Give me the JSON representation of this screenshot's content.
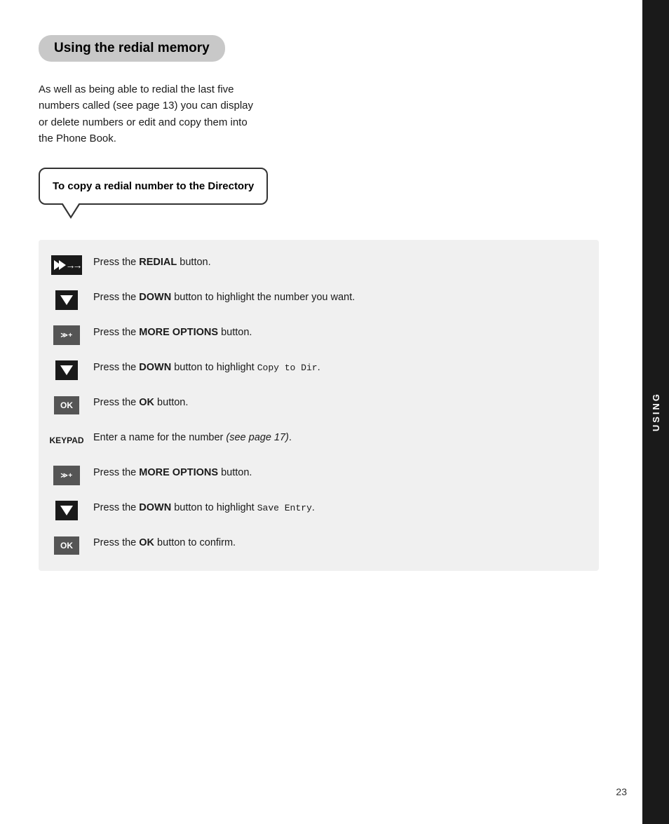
{
  "page": {
    "title": "Using the redial memory",
    "intro": "As well as being able to redial the last five numbers called (see page 13) you can display or delete numbers or edit and copy them into the Phone Book.",
    "callout_title": "To copy a redial number to the Directory",
    "steps": [
      {
        "icon_type": "redial",
        "text_parts": [
          {
            "text": "Press the ",
            "bold": false
          },
          {
            "text": "REDIAL",
            "bold": true
          },
          {
            "text": " button.",
            "bold": false
          }
        ]
      },
      {
        "icon_type": "down",
        "text_parts": [
          {
            "text": "Press the ",
            "bold": false
          },
          {
            "text": "DOWN",
            "bold": true
          },
          {
            "text": " button to highlight the number you want.",
            "bold": false
          }
        ]
      },
      {
        "icon_type": "more",
        "text_parts": [
          {
            "text": "Press the ",
            "bold": false
          },
          {
            "text": "MORE OPTIONS",
            "bold": true
          },
          {
            "text": " button.",
            "bold": false
          }
        ]
      },
      {
        "icon_type": "down",
        "text_parts": [
          {
            "text": "Press the ",
            "bold": false
          },
          {
            "text": "DOWN",
            "bold": true
          },
          {
            "text": " button to highlight ",
            "bold": false
          },
          {
            "text": "Copy to Dir",
            "bold": false,
            "mono": true
          },
          {
            "text": ".",
            "bold": false
          }
        ]
      },
      {
        "icon_type": "ok",
        "text_parts": [
          {
            "text": "Press the ",
            "bold": false
          },
          {
            "text": "OK",
            "bold": true
          },
          {
            "text": " button.",
            "bold": false
          }
        ]
      },
      {
        "icon_type": "keypad",
        "text_parts": [
          {
            "text": "Enter a name for the number ",
            "bold": false
          },
          {
            "text": "(see page 17)",
            "bold": false,
            "italic": true
          },
          {
            "text": ".",
            "bold": false
          }
        ]
      },
      {
        "icon_type": "more",
        "text_parts": [
          {
            "text": "Press the ",
            "bold": false
          },
          {
            "text": "MORE OPTIONS",
            "bold": true
          },
          {
            "text": " button.",
            "bold": false
          }
        ]
      },
      {
        "icon_type": "down",
        "text_parts": [
          {
            "text": "Press the ",
            "bold": false
          },
          {
            "text": "DOWN",
            "bold": true
          },
          {
            "text": " button to highlight ",
            "bold": false
          },
          {
            "text": "Save Entry",
            "bold": false,
            "mono": true
          },
          {
            "text": ".",
            "bold": false
          }
        ]
      },
      {
        "icon_type": "ok",
        "text_parts": [
          {
            "text": "Press the ",
            "bold": false
          },
          {
            "text": "OK",
            "bold": true
          },
          {
            "text": " button to confirm.",
            "bold": false
          }
        ]
      }
    ],
    "sidebar_label": "USING",
    "page_number": "23"
  }
}
